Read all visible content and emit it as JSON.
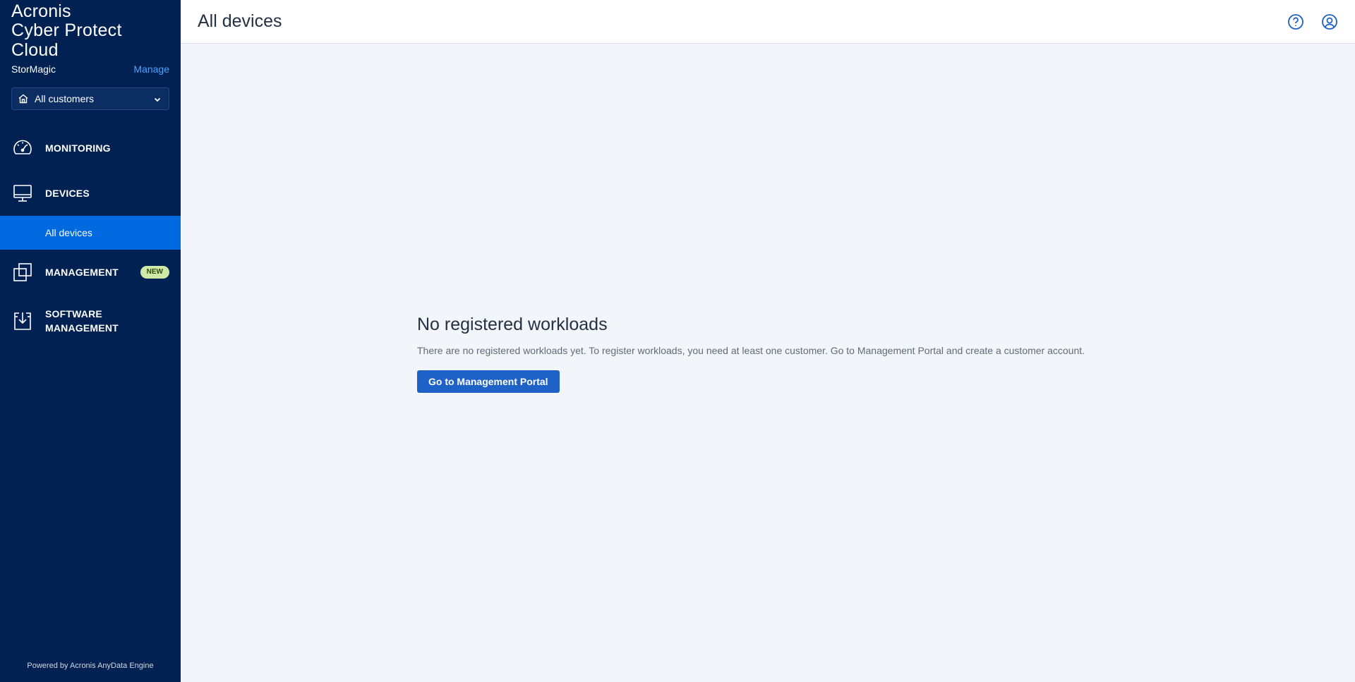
{
  "brand": {
    "name": "Acronis",
    "product": "Cyber Protect Cloud"
  },
  "tenant": {
    "name": "StorMagic",
    "manage_label": "Manage"
  },
  "customer_select": {
    "value": "All customers",
    "icon": "house-icon"
  },
  "nav": {
    "monitoring": {
      "label": "MONITORING",
      "icon": "speedometer-icon"
    },
    "devices": {
      "label": "DEVICES",
      "icon": "monitor-icon"
    },
    "all_devices": {
      "label": "All devices"
    },
    "management": {
      "label": "MANAGEMENT",
      "icon": "stacked-squares-icon",
      "badge": "NEW"
    },
    "software_management": {
      "label_line1": "SOFTWARE",
      "label_line2": "MANAGEMENT",
      "icon": "download-box-icon"
    }
  },
  "footer": {
    "powered_by": "Powered by Acronis AnyData Engine"
  },
  "header": {
    "title": "All devices",
    "help_icon": "help-icon",
    "account_icon": "user-account-icon"
  },
  "empty_state": {
    "title": "No registered workloads",
    "text": "There are no registered workloads yet. To register workloads, you need at least one customer. Go to Management Portal and create a customer account.",
    "button_label": "Go to Management Portal"
  },
  "colors": {
    "sidebar_bg": "#002152",
    "active_item": "#0069e0",
    "primary_button": "#1e62c7",
    "link": "#4aa5ff",
    "badge_bg": "#cfe8a8",
    "content_bg": "#f2f6fa"
  }
}
